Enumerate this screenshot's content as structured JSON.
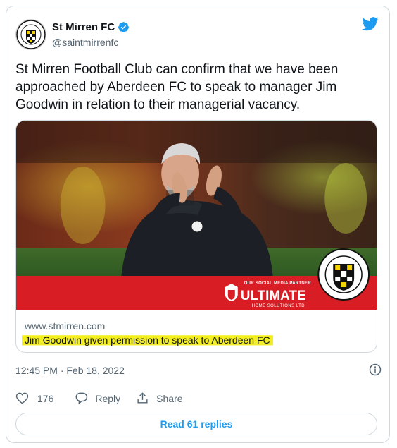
{
  "tweet": {
    "display_name": "St Mirren FC",
    "handle": "@saintmirrenfc",
    "text": "St Mirren Football Club can confirm that we have been approached by Aberdeen FC to speak to manager Jim Goodwin in relation to their managerial vacancy.",
    "timestamp": "12:45 PM · Feb 18, 2022"
  },
  "link_card": {
    "domain": "www.stmirren.com",
    "title": "Jim Goodwin given permission to speak to Aberdeen FC",
    "partner_top": "OUR SOCIAL MEDIA PARTNER",
    "partner_name": "ULTIMATE",
    "partner_sub": "HOME SOLUTIONS LTD"
  },
  "actions": {
    "like_count": "176",
    "reply_label": "Reply",
    "share_label": "Share"
  },
  "read_replies_label": "Read 61 replies",
  "colors": {
    "accent": "#1d9bf0",
    "highlight": "#f2ed2b",
    "banner_red": "#d81e24"
  },
  "icons": [
    "st-mirren-crest",
    "verified-badge-icon",
    "twitter-bird-icon",
    "info-icon",
    "heart-icon",
    "reply-icon",
    "share-icon"
  ]
}
